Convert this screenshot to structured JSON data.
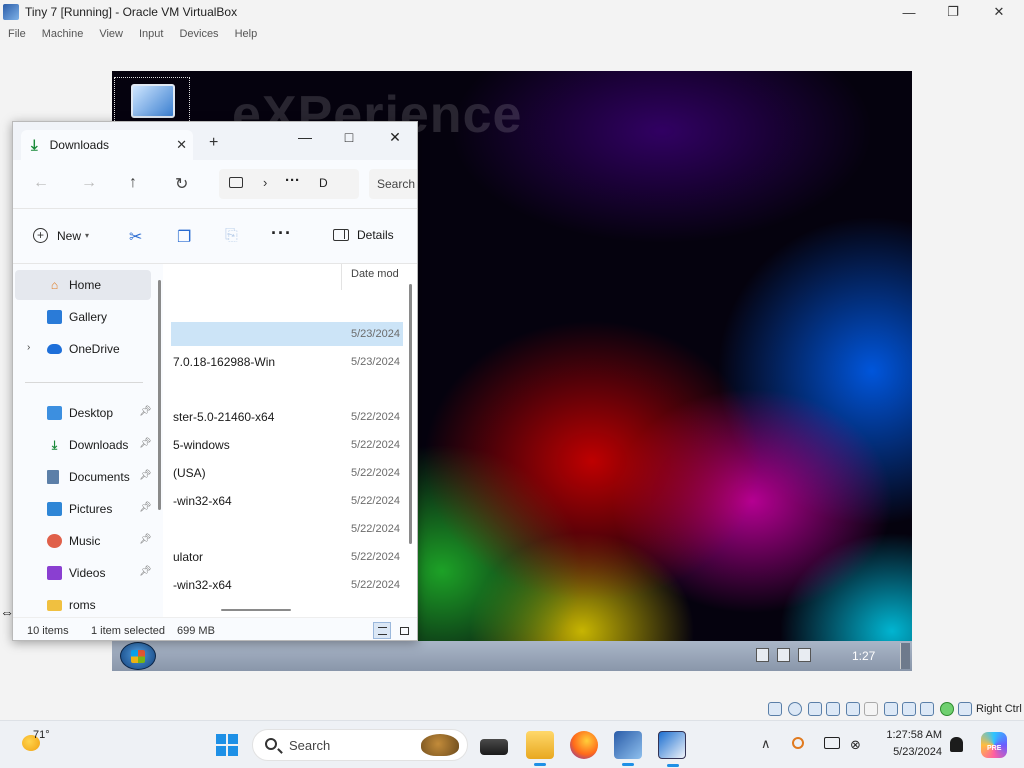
{
  "vbox": {
    "title": "Tiny 7 [Running] - Oracle VM VirtualBox",
    "menu": [
      "File",
      "Machine",
      "View",
      "Input",
      "Devices",
      "Help"
    ],
    "host_key": "Right Ctrl"
  },
  "guest": {
    "watermark": "eXPerience",
    "clock": "1:27"
  },
  "explorer": {
    "tab_label": "Downloads",
    "new_tab_glyph": "+",
    "address": {
      "more": "···",
      "segment": "D"
    },
    "search_placeholder": "Search",
    "toolbar": {
      "new_label": "New",
      "details_label": "Details",
      "more_glyph": "···"
    },
    "nav_items": [
      {
        "label": "Home",
        "icon": "home-icon",
        "selected": true
      },
      {
        "label": "Gallery",
        "icon": "gallery-icon"
      },
      {
        "label": "OneDrive",
        "icon": "cloud-icon",
        "expandable": true
      },
      {
        "label": "Desktop",
        "icon": "desktop-folder-icon",
        "pinned": true
      },
      {
        "label": "Downloads",
        "icon": "download-icon",
        "pinned": true
      },
      {
        "label": "Documents",
        "icon": "documents-icon",
        "pinned": true
      },
      {
        "label": "Pictures",
        "icon": "pictures-icon",
        "pinned": true
      },
      {
        "label": "Music",
        "icon": "music-icon",
        "pinned": true
      },
      {
        "label": "Videos",
        "icon": "videos-icon",
        "pinned": true
      },
      {
        "label": "roms",
        "icon": "folder-icon"
      }
    ],
    "column_header": "Date mod",
    "files": [
      {
        "name": "",
        "date": "5/23/2024",
        "selected": true
      },
      {
        "name": "7.0.18-162988-Win",
        "date": "5/23/2024"
      },
      {
        "name": "ster-5.0-21460-x64",
        "date": "5/22/2024"
      },
      {
        "name": "5-windows",
        "date": "5/22/2024"
      },
      {
        "name": " (USA)",
        "date": "5/22/2024"
      },
      {
        "name": "-win32-x64",
        "date": "5/22/2024"
      },
      {
        "name": "",
        "date": "5/22/2024"
      },
      {
        "name": "ulator",
        "date": "5/22/2024"
      },
      {
        "name": "-win32-x64",
        "date": "5/22/2024"
      }
    ],
    "status": {
      "count": "10 items",
      "selection": "1 item selected",
      "size": "699 MB"
    }
  },
  "taskbar": {
    "weather_temp": "71°",
    "search_label": "Search",
    "time": "1:27:58 AM",
    "date": "5/23/2024",
    "copilot_badge": "PRE"
  },
  "colors": {
    "accent": "#1e90e6",
    "selection": "#cce4f7",
    "guest_taskbar": "#aab6c8"
  }
}
